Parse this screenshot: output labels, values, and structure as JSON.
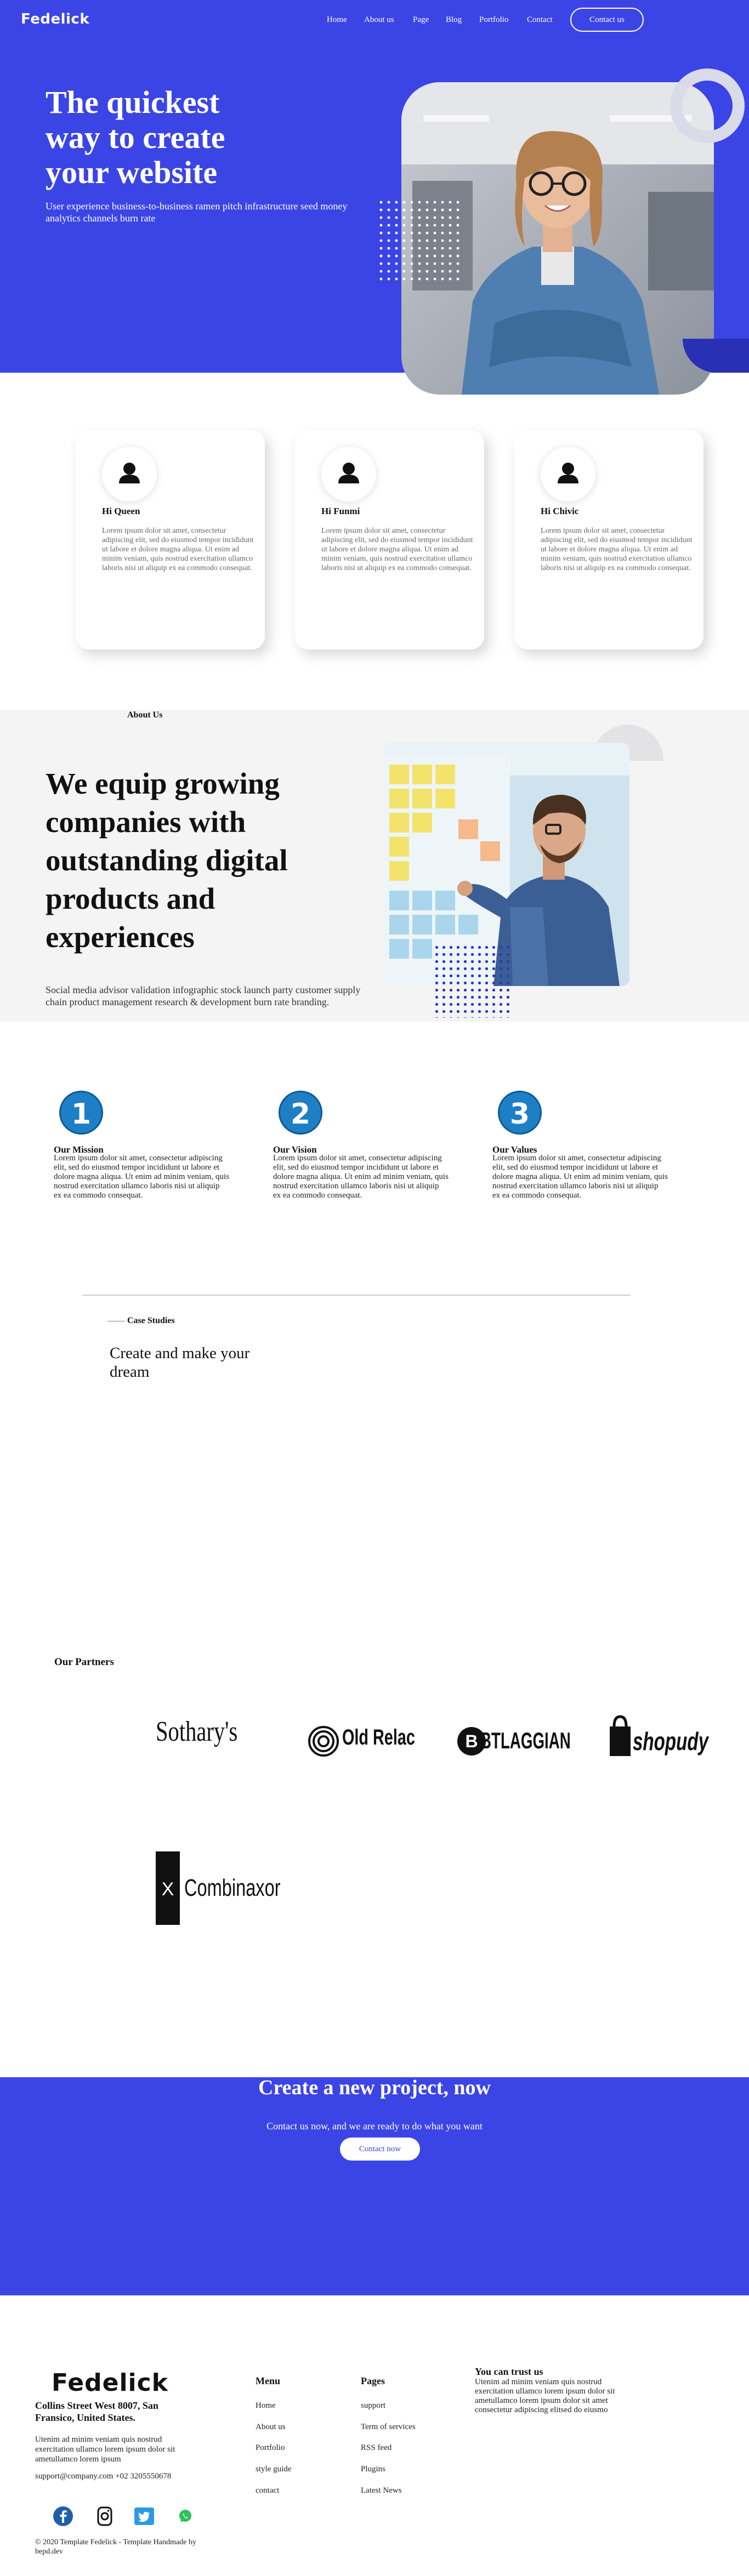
{
  "header": {
    "logo": "Fedelick",
    "nav": [
      "Home",
      "About us",
      "Page",
      "Blog",
      "Portfolio",
      "Contact"
    ],
    "cta_label": "Contact us"
  },
  "hero": {
    "title": "The quickest way to create your website",
    "subtitle": "User experience business-to-business ramen pitch infrastructure seed money analytics channels burn rate"
  },
  "services": [
    {
      "icon": "user-icon",
      "title": "Hi Queen",
      "text": "Lorem ipsum dolor sit amet, consectetur adipiscing elit, sed do eiusmod tempor incididunt ut labore et dolore magna aliqua. Ut enim ad minim veniam, quis nostrud exercitation ullamco laboris nisi ut aliquip ex ea commodo consequat."
    },
    {
      "icon": "user-icon",
      "title": "Hi Funmi",
      "text": "Lorem ipsum dolor sit amet, consectetur adipiscing elit, sed do eiusmod tempor incididunt ut labore et dolore magna aliqua. Ut enim ad minim veniam, quis nostrud exercitation ullamco laboris nisi ut aliquip ex ea commodo consequat."
    },
    {
      "icon": "user-icon",
      "title": "Hi Chivic",
      "text": "Lorem ipsum dolor sit amet, consectetur adipiscing elit, sed do eiusmod tempor incididunt ut labore et dolore magna aliqua. Ut enim ad minim veniam, quis nostrud exercitation ullamco laboris nisi ut aliquip ex ea commodo consequat."
    }
  ],
  "about": {
    "eyebrow": "About Us",
    "title": "We equip growing companies with outstanding digital products and experiences",
    "text": "Social media advisor validation infographic stock launch party customer supply chain product management research & development burn rate branding."
  },
  "mission": [
    {
      "num": "1",
      "title": "Our Mission",
      "text": "Lorem ipsum dolor sit amet, consectetur adipiscing elit, sed do eiusmod tempor incididunt ut labore et dolore magna aliqua. Ut enim ad minim veniam, quis nostrud exercitation ullamco laboris nisi ut aliquip ex ea commodo consequat."
    },
    {
      "num": "2",
      "title": "Our Vision",
      "text": "Lorem ipsum dolor sit amet, consectetur adipiscing elit, sed do eiusmod tempor incididunt ut labore et dolore magna aliqua. Ut enim ad minim veniam, quis nostrud exercitation ullamco laboris nisi ut aliquip ex ea commodo consequat."
    },
    {
      "num": "3",
      "title": "Our Values",
      "text": "Lorem ipsum dolor sit amet, consectetur adipiscing elit, sed do eiusmod tempor incididunt ut labore et dolore magna aliqua. Ut enim ad minim veniam, quis nostrud exercitation ullamco laboris nisi ut aliquip ex ea commodo consequat."
    }
  ],
  "case_studies": {
    "eyebrow": "Case Studies",
    "title": "Create and make your dream"
  },
  "partners": {
    "title": "Our Partners",
    "logos": [
      "Sothary's",
      "Old Relac",
      "BTLAGGIAN",
      "shopudy",
      "Combinaxor"
    ]
  },
  "cta": {
    "title": "Create a new project, now",
    "text": "Contact us now, and we are ready to do what you want",
    "button": "Contact now"
  },
  "footer": {
    "logo": "Fedelick",
    "address": "Collins Street West 8007, San Fransico, United States.",
    "desc": "Utenim ad minim veniam quis nostrud exercitation ullamco lorem ipsum dolor sit ametullamco lorem ipsum",
    "contact": "support@company.com +02 3205550678",
    "menu_title": "Menu",
    "menu": [
      "Home",
      "About us",
      "Portfolio",
      "style guide",
      "contact"
    ],
    "pages_title": "Pages",
    "pages": [
      "support",
      "Term of services",
      "RSS feed",
      "Plugins",
      "Latest News"
    ],
    "trust_title": "You can trust us",
    "trust_text": "Utenim ad minim veniam quis nostrud exercitation ullamco lorem ipsum dolor sit ametullamco lorem ipsum dolor sit amet consectetur adipiscing elitsed do eiusmo",
    "social": [
      "facebook-icon",
      "instagram-icon",
      "twitter-icon",
      "whatsapp-icon"
    ],
    "copyright": "© 2020 Template Fedelick - Template Handmade by bepd.dev"
  },
  "colors": {
    "primary": "#3b45e6",
    "dark_blue": "#2a30b5",
    "number_badge": "#1e7fc4",
    "light_bg": "#f4f4f4"
  }
}
